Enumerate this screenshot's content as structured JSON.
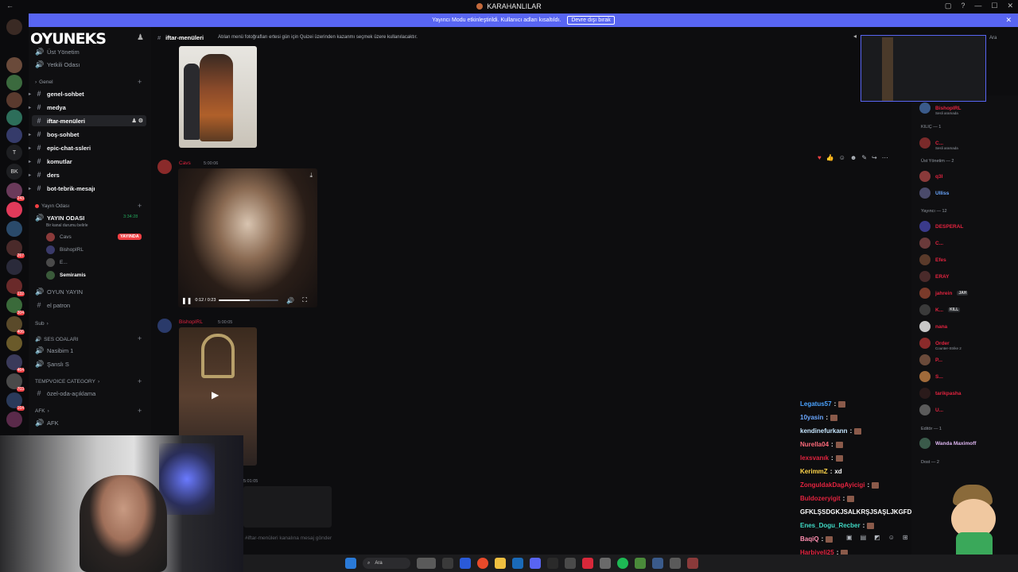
{
  "titlebar": {
    "title": "KARAHANLILAR",
    "back": "←"
  },
  "banner": {
    "text": "Yayıncı Modu etkinleştirildi. Kullanıcı adları kısaltıldı.",
    "button": "Devre dışı bırak",
    "close": "✕"
  },
  "server": {
    "logo_text": "OYUNEKS"
  },
  "channels": {
    "top_items": [
      {
        "label": "Üst Yönetim"
      },
      {
        "label": "Yetkili Odası"
      }
    ],
    "genel_category": "Genel",
    "genel_items": [
      {
        "label": "genel-sohbet"
      },
      {
        "label": "medya"
      },
      {
        "label": "iftar-menüleri"
      },
      {
        "label": "boş-sohbet"
      },
      {
        "label": "epic-chat-ssleri"
      },
      {
        "label": "komutlar"
      },
      {
        "label": "ders"
      },
      {
        "label": "bot-tebrik-mesajı"
      }
    ],
    "yayin_category": "Yayın Odası",
    "yayin_voice": "YAYIN ODASI",
    "yayin_timer": "3:34:28",
    "yayin_status": "Bir kanal durumu belirle",
    "voice_users": [
      {
        "name": "Cavs"
      },
      {
        "name": "BishopIRL"
      },
      {
        "name": "E..."
      },
      {
        "name": "Semiramis"
      }
    ],
    "live_badge": "YAYINDA",
    "extra_voice": [
      {
        "label": "OYUN YAYIN"
      },
      {
        "label": "el patron"
      }
    ],
    "sub_category": "Sub",
    "ses_category": "SES ODALARI",
    "ses_items": [
      {
        "label": "Nasibim 1"
      },
      {
        "label": "Şanslı S"
      }
    ],
    "tempvoice_category": "TEMPVOICE CATEGORY",
    "tempvoice_items": [
      {
        "label": "özel-oda-açıklama"
      }
    ],
    "afk_category": "AFK",
    "afk_items": [
      {
        "label": "AFK"
      }
    ]
  },
  "chat": {
    "channel_name": "iftar-menüleri",
    "topic": "Atılan menü fotoğrafları ertesi gün için Quizei üzerinden kazanmı seçmek üzere kullanılacaktır.",
    "messages": [
      {
        "author": "Cavs",
        "time": "5:00:06"
      },
      {
        "author": "BishopIRL",
        "time": "5:00:05"
      },
      {
        "author": "",
        "time": "5:01:05"
      }
    ],
    "video": {
      "time": "0:12 / 0:23",
      "progress": 0.52
    },
    "input_placeholder": "#iftar-menüleri kanalına mesaj gönder"
  },
  "stream_chat": [
    {
      "user": "Legatus57",
      "msg": "",
      "color": "#4aa3ff"
    },
    {
      "user": "10yasin",
      "msg": "",
      "color": "#6aa7ff"
    },
    {
      "user": "kendinefurkann",
      "msg": "",
      "color": "#c6e6ff"
    },
    {
      "user": "Nurella04",
      "msg": "",
      "color": "#ff6a7a"
    },
    {
      "user": "lexsvanık",
      "msg": "",
      "color": "#e3233f"
    },
    {
      "user": "KerimmZ",
      "msg": "xd",
      "color": "#ffd54a"
    },
    {
      "user": "ZonguldakDagAyicigi",
      "msg": "",
      "color": "#e3233f"
    },
    {
      "user": "Buldozeryigit",
      "msg": "",
      "color": "#e3233f"
    },
    {
      "user": "",
      "msg": "GFKLŞSDGKJSALKRŞJSAŞLJKGFDJLSKAGSDF",
      "color": "#ffffff"
    },
    {
      "user": "Enes_Dogu_Recber",
      "msg": "",
      "color": "#3fd9c4"
    },
    {
      "user": "BaqiQ",
      "msg": "",
      "color": "#ff8fb1"
    },
    {
      "user": "Harbiyeli25",
      "msg": "",
      "color": "#e3233f"
    }
  ],
  "members": {
    "groups": [
      {
        "label": "KILIÇ — 1"
      },
      {
        "label": "Üst Yönetim — 2"
      },
      {
        "label": "Yayıncı — 12"
      },
      {
        "label": "Editör — 1"
      },
      {
        "label": "Dost — 2"
      }
    ],
    "list": [
      {
        "name": "BishopIRL",
        "sub": "Sesli aramada",
        "color": "#e3233f"
      },
      {
        "name": "C...",
        "sub": "Sesli aramada",
        "color": "#e3233f"
      },
      {
        "name": "q3l",
        "sub": "",
        "color": "#e3233f"
      },
      {
        "name": "Ulliss",
        "sub": "",
        "color": "#6aa7ff"
      },
      {
        "name": "DESPERAL",
        "sub": "",
        "color": "#e3233f"
      },
      {
        "name": "C...",
        "sub": "",
        "color": "#e3233f"
      },
      {
        "name": "Efes",
        "sub": "",
        "color": "#e3233f"
      },
      {
        "name": "ERAY",
        "sub": "",
        "color": "#e3233f"
      },
      {
        "name": "jahrein",
        "sub": "",
        "color": "#e3233f",
        "tag": "JAH"
      },
      {
        "name": "K...",
        "sub": "",
        "color": "#e3233f",
        "tag": "KILL"
      },
      {
        "name": "nana",
        "sub": "",
        "color": "#e3233f"
      },
      {
        "name": "Order",
        "sub": "Counter-Strike 2",
        "color": "#e3233f"
      },
      {
        "name": "P...",
        "sub": "",
        "color": "#e3233f"
      },
      {
        "name": "S...",
        "sub": "",
        "color": "#e3233f"
      },
      {
        "name": "tarikpasha",
        "sub": "",
        "color": "#e3233f"
      },
      {
        "name": "U...",
        "sub": "",
        "color": "#e3233f"
      },
      {
        "name": "Wanda Maximoff",
        "sub": "",
        "color": "#ddb5f0"
      }
    ],
    "search_text": "Ara"
  },
  "taskbar": {
    "search": "Ara"
  },
  "icons": {
    "hash": "#",
    "voice": "🔊",
    "gear": "⚙",
    "pencil": "✎",
    "plus": "+",
    "chevron": "›"
  }
}
